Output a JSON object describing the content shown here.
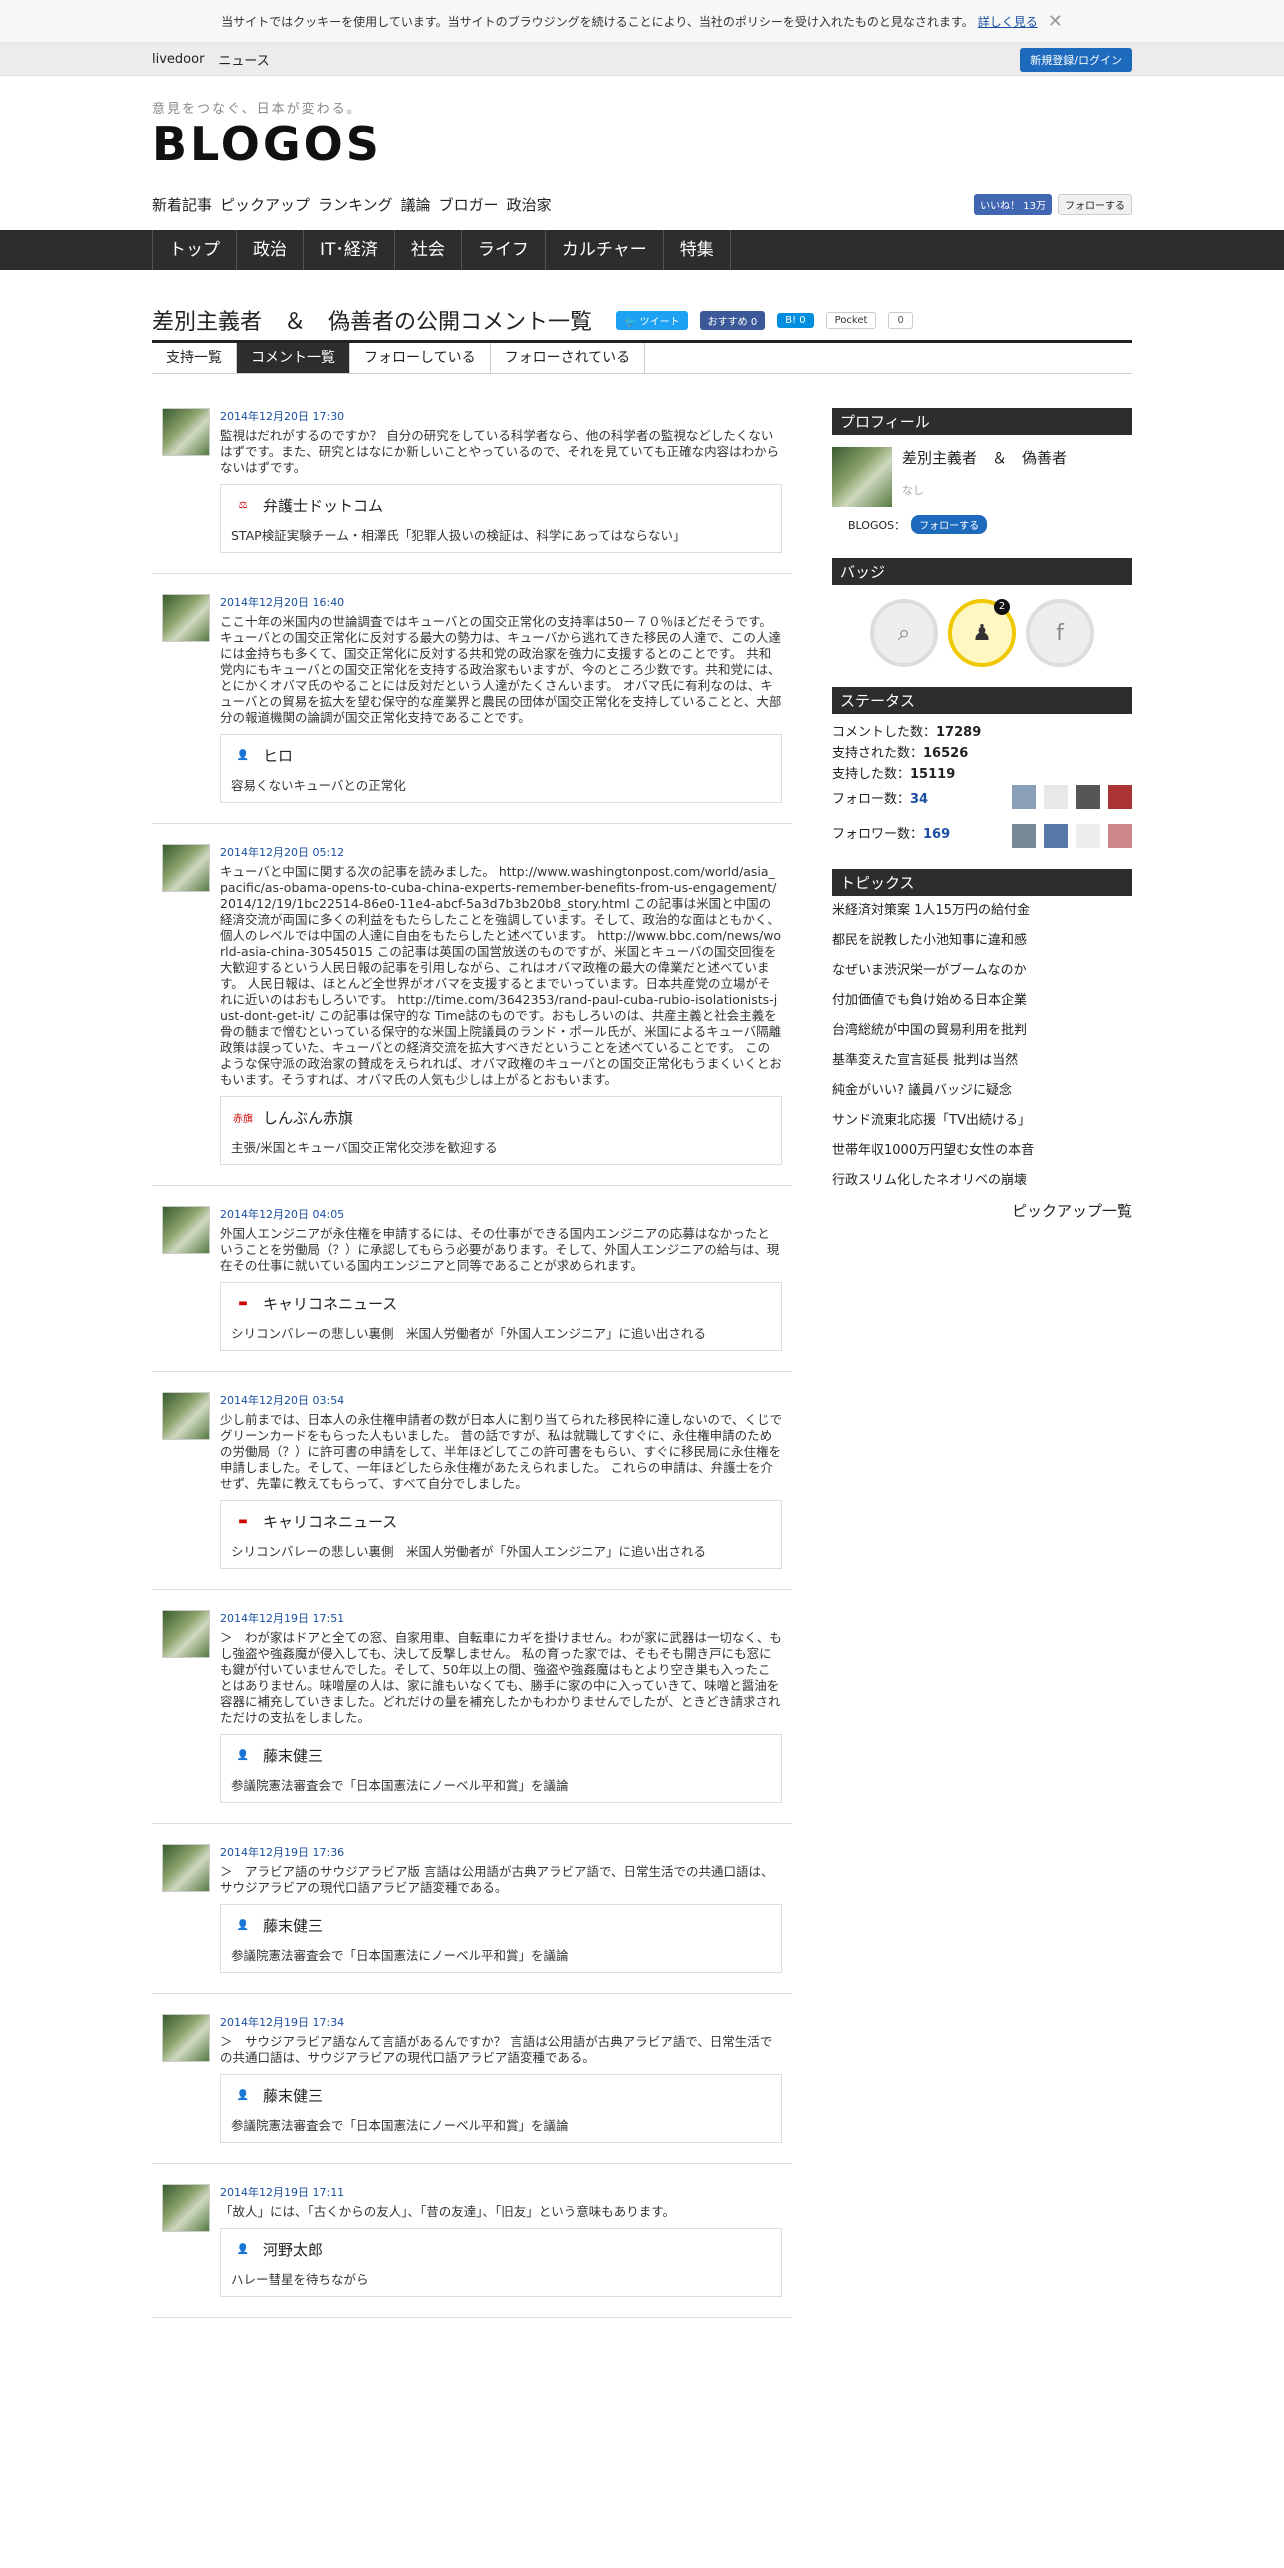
{
  "cookie": {
    "text": "当サイトではクッキーを使用しています。当サイトのブラウジングを続けることにより、当社のポリシーを受け入れたものと見なされます。",
    "more": "詳しく見る"
  },
  "topbar": {
    "livedoor": "livedoor",
    "news": "ニュース",
    "login": "新規登録/ログイン"
  },
  "header": {
    "tagline": "意見をつなぐ、日本が変わる。",
    "logo": "BLOGOS",
    "gnav": [
      "新着記事",
      "ピックアップ",
      "ランキング",
      "議論",
      "ブロガー",
      "政治家"
    ],
    "fb_like": "いいね！ 13万",
    "tw_follow": "フォローする"
  },
  "catnav": [
    "トップ",
    "政治",
    "IT･経済",
    "社会",
    "ライフ",
    "カルチャー",
    "特集"
  ],
  "page": {
    "title": "差別主義者　＆　偽善者の公開コメント一覧",
    "tweet": "ツイート",
    "fb_count": "おすすめ 0",
    "hb_count": "0",
    "pocket": "Pocket",
    "pocket_count": "0"
  },
  "tabs": [
    "支持一覧",
    "コメント一覧",
    "フォローしている",
    "フォローされている"
  ],
  "comments": [
    {
      "date": "2014年12月20日 17:30",
      "text": "監視はだれがするのですか？ 自分の研究をしている科学者なら、他の科学者の監視などしたくないはずです。また、研究とはなにか新しいことやっているので、それを見ていても正確な内容はわからないはずです。",
      "source": "弁護士ドットコム",
      "article": "STAP検証実験チーム・相澤氏「犯罪人扱いの検証は、科学にあってはならない」"
    },
    {
      "date": "2014年12月20日 16:40",
      "text": "ここ十年の米国内の世論調査ではキューバとの国交正常化の支持率は50－７０％ほどだそうです。 キューバとの国交正常化に反対する最大の勢力は、キューバから逃れてきた移民の人達で、この人達には金持ちも多くて、国交正常化に反対する共和党の政治家を強力に支援するとのことです。 共和党内にもキューバとの国交正常化を支持する政治家もいますが、今のところ少数です。共和党には、とにかくオバマ氏のやることには反対だという人達がたくさんいます。 オバマ氏に有利なのは、キューバとの貿易を拡大を望む保守的な産業界と農民の団体が国交正常化を支持していることと、大部分の報道機関の論調が国交正常化支持であることです。",
      "source": "ヒロ",
      "article": "容易くないキューバとの正常化"
    },
    {
      "date": "2014年12月20日 05:12",
      "text": "キューバと中国に関する次の記事を読みました。 http://www.washingtonpost.com/world/asia_pacific/as-obama-opens-to-cuba-china-experts-remember-benefits-from-us-engagement/2014/12/19/1bc22514-86e0-11e4-abcf-5a3d7b3b20b8_story.html この記事は米国と中国の経済交流が両国に多くの利益をもたらしたことを強調しています。そして、政治的な面はともかく、個人のレベルでは中国の人達に自由をもたらしたと述べています。 http://www.bbc.com/news/world-asia-china-30545015 この記事は英国の国営放送のものですが、米国とキューバの国交回復を大歓迎するという人民日報の記事を引用しながら、これはオバマ政権の最大の偉業だと述べています。 人民日報は、ほとんど全世界がオバマを支援するとまでいっています。日本共産党の立場がそれに近いのはおもしろいです。 http://time.com/3642353/rand-paul-cuba-rubio-isolationists-just-dont-get-it/ この記事は保守的な Time誌のものです。おもしろいのは、共産主義と社会主義を骨の髄まで憎むといっている保守的な米国上院議員のランド・ポール氏が、米国によるキューバ隔離政策は誤っていた、キューバとの経済交流を拡大すべきだということを述べていることです。 このような保守派の政治家の賛成をえられれば、オバマ政権のキューバとの国交正常化もうまくいくとおもいます。そうすれば、オバマ氏の人気も少しは上がるとおもいます。",
      "source": "しんぶん赤旗",
      "article": "主張/米国とキューバ国交正常化交渉を歓迎する"
    },
    {
      "date": "2014年12月20日 04:05",
      "text": "外国人エンジニアが永住権を申請するには、その仕事ができる国内エンジニアの応募はなかったということを労働局（？）に承認してもらう必要があります。そして、外国人エンジニアの給与は、現在その仕事に就いている国内エンジニアと同等であることが求められます。",
      "source": "キャリコネニュース",
      "article": "シリコンバレーの悲しい裏側　米国人労働者が「外国人エンジニア」に追い出される"
    },
    {
      "date": "2014年12月20日 03:54",
      "text": "少し前までは、日本人の永住権申請者の数が日本人に割り当てられた移民枠に達しないので、くじでグリーンカードをもらった人もいました。 昔の話ですが、私は就職してすぐに、永住権申請のための労働局（？）に許可書の申請をして、半年ほどしてこの許可書をもらい、すぐに移民局に永住権を申請しました。そして、一年ほどしたら永住権があたえられました。 これらの申請は、弁護士を介せず、先輩に教えてもらって、すべて自分でしました。",
      "source": "キャリコネニュース",
      "article": "シリコンバレーの悲しい裏側　米国人労働者が「外国人エンジニア」に追い出される"
    },
    {
      "date": "2014年12月19日 17:51",
      "text": "＞　わが家はドアと全ての窓、自家用車、自転車にカギを掛けません。わが家に武器は一切なく、もし強盗や強姦魔が侵入しても、決して反撃しません。 私の育った家では、そもそも開き戸にも窓にも鍵が付いていませんでした。そして、50年以上の間、強盗や強姦魔はもとより空き巣も入ったことはありません。味噌屋の人は、家に誰もいなくても、勝手に家の中に入っていきて、味噌と醤油を容器に補充していきました。どれだけの量を補充したかもわかりませんでしたが、ときどき請求されただけの支払をしました。",
      "source": "藤末健三",
      "article": "参議院憲法審査会で「日本国憲法にノーベル平和賞」を議論"
    },
    {
      "date": "2014年12月19日 17:36",
      "text": "＞　アラビア語のサウジアラビア版 言語は公用語が古典アラビア語で、日常生活での共通口語は、サウジアラビアの現代口語アラビア語変種である。",
      "source": "藤末健三",
      "article": "参議院憲法審査会で「日本国憲法にノーベル平和賞」を議論"
    },
    {
      "date": "2014年12月19日 17:34",
      "text": "＞　サウジアラビア語なんて言語があるんですか？ 言語は公用語が古典アラビア語で、日常生活での共通口語は、サウジアラビアの現代口語アラビア語変種である。",
      "source": "藤末健三",
      "article": "参議院憲法審査会で「日本国憲法にノーベル平和賞」を議論"
    },
    {
      "date": "2014年12月19日 17:11",
      "text": "「故人」には、「古くからの友人」、「昔の友達」、「旧友」という意味もあります。",
      "source": "河野太郎",
      "article": "ハレー彗星を待ちながら"
    }
  ],
  "sidebar": {
    "profile_title": "プロフィール",
    "name": "差別主義者　＆　偽善者",
    "none": "なし",
    "blogos_label": "BLOGOS：",
    "follow_btn": "フォローする",
    "badge_title": "バッジ",
    "badge_count": "2",
    "status_title": "ステータス",
    "stats": [
      {
        "label": "コメントした数：",
        "value": "17289"
      },
      {
        "label": "支持された数：",
        "value": "16526"
      },
      {
        "label": "支持した数：",
        "value": "15119"
      },
      {
        "label": "フォロー数：",
        "value": "34"
      },
      {
        "label": "フォロワー数：",
        "value": "169"
      }
    ],
    "topics_title": "トピックス",
    "topics": [
      "米経済対策案 1人15万円の給付金",
      "都民を説教した小池知事に違和感",
      "なぜいま渋沢栄一がブームなのか",
      "付加価値でも負け始める日本企業",
      "台湾総統が中国の貿易利用を批判",
      "基準変えた宣言延長 批判は当然",
      "純金がいい? 議員バッジに疑念",
      "サンド流東北応援「TV出続ける」",
      "世帯年収1000万円望む女性の本音",
      "行政スリム化したネオリベの崩壊"
    ],
    "pickup_more": "ピックアップ一覧"
  },
  "colors": {
    "accent": "#1e6bbd",
    "dark": "#2d2d2d",
    "link": "#1a4fa1"
  }
}
